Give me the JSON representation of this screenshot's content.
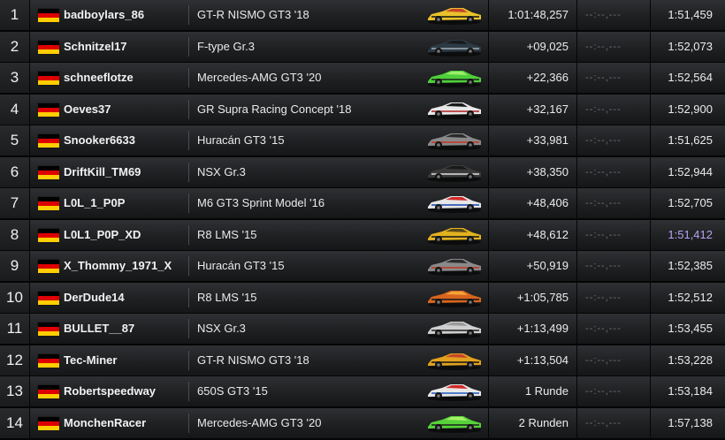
{
  "colors": {
    "fastest_lap": "#b8a2f2",
    "empty_field": "#6f7074",
    "flag": [
      "#000000",
      "#dd0000",
      "#ffce00"
    ]
  },
  "rows": [
    {
      "pos": "1",
      "flag": "flag-germany-icon",
      "name": "badboylars_86",
      "car": "GT-R NISMO GT3 '18",
      "car_colors": [
        "#e9c22a",
        "#1a1a1a",
        "#c7462c"
      ],
      "gap": "1:01:48,257",
      "empty": "--:--,---",
      "lap": "1:51,459",
      "fastest": false
    },
    {
      "pos": "2",
      "flag": "flag-germany-icon",
      "name": "Schnitzel17",
      "car": "F-type Gr.3",
      "car_colors": [
        "#2b3a44",
        "#9aa7b0",
        "#1a1a1a"
      ],
      "gap": "+09,025",
      "empty": "--:--,---",
      "lap": "1:52,073",
      "fastest": false
    },
    {
      "pos": "3",
      "flag": "flag-germany-icon",
      "name": "schneeflotze",
      "car": "Mercedes-AMG GT3 '20",
      "car_colors": [
        "#4fcf3a",
        "#1e2a1e",
        "#9bef6a"
      ],
      "gap": "+22,366",
      "empty": "--:--,---",
      "lap": "1:52,564",
      "fastest": false
    },
    {
      "pos": "4",
      "flag": "flag-germany-icon",
      "name": "Oeves37",
      "car": "GR Supra Racing Concept '18",
      "car_colors": [
        "#e8e8e8",
        "#b32a2a",
        "#1a1a1a"
      ],
      "gap": "+32,167",
      "empty": "--:--,---",
      "lap": "1:52,900",
      "fastest": false
    },
    {
      "pos": "5",
      "flag": "flag-germany-icon",
      "name": "Snooker6633",
      "car": "Huracán GT3 '15",
      "car_colors": [
        "#8a8a8a",
        "#c13a2a",
        "#2a2a2a"
      ],
      "gap": "+33,981",
      "empty": "--:--,---",
      "lap": "1:51,625",
      "fastest": false
    },
    {
      "pos": "6",
      "flag": "flag-germany-icon",
      "name": "DriftKill_TM69",
      "car": "NSX Gr.3",
      "car_colors": [
        "#3a3a3a",
        "#d7d7d7",
        "#1a1a1a"
      ],
      "gap": "+38,350",
      "empty": "--:--,---",
      "lap": "1:52,944",
      "fastest": false
    },
    {
      "pos": "7",
      "flag": "flag-germany-icon",
      "name": "L0L_1_P0P",
      "car": "M6 GT3 Sprint Model '16",
      "car_colors": [
        "#e6e6e6",
        "#1f4fb5",
        "#d22a2a"
      ],
      "gap": "+48,406",
      "empty": "--:--,---",
      "lap": "1:52,705",
      "fastest": false
    },
    {
      "pos": "8",
      "flag": "flag-germany-icon",
      "name": "L0L1_P0P_XD",
      "car": "R8 LMS '15",
      "car_colors": [
        "#e2b21f",
        "#1a1a1a",
        "#5a4a1a"
      ],
      "gap": "+48,612",
      "empty": "--:--,---",
      "lap": "1:51,412",
      "fastest": true
    },
    {
      "pos": "9",
      "flag": "flag-germany-icon",
      "name": "X_Thommy_1971_X",
      "car": "Huracán GT3 '15",
      "car_colors": [
        "#8a8a8a",
        "#b83a2a",
        "#2a2a2a"
      ],
      "gap": "+50,919",
      "empty": "--:--,---",
      "lap": "1:52,385",
      "fastest": false
    },
    {
      "pos": "10",
      "flag": "flag-germany-icon",
      "name": "DerDude14",
      "car": "R8 LMS '15",
      "car_colors": [
        "#d8651e",
        "#1a1a1a",
        "#f2a43a"
      ],
      "gap": "+1:05,785",
      "empty": "--:--,---",
      "lap": "1:52,512",
      "fastest": false
    },
    {
      "pos": "11",
      "flag": "flag-germany-icon",
      "name": "BULLET__87",
      "car": "NSX Gr.3",
      "car_colors": [
        "#cfcfcf",
        "#2a2a2a",
        "#9a9a9a"
      ],
      "gap": "+1:13,499",
      "empty": "--:--,---",
      "lap": "1:53,455",
      "fastest": false
    },
    {
      "pos": "12",
      "flag": "flag-germany-icon",
      "name": "Tec-Miner",
      "car": "GT-R NISMO GT3 '18",
      "car_colors": [
        "#e2a21f",
        "#1a1a1a",
        "#c7462c"
      ],
      "gap": "+1:13,504",
      "empty": "--:--,---",
      "lap": "1:53,228",
      "fastest": false
    },
    {
      "pos": "13",
      "flag": "flag-germany-icon",
      "name": "Robertspeedway",
      "car": "650S GT3 '15",
      "car_colors": [
        "#e8e8e8",
        "#2a5fc0",
        "#d22a2a"
      ],
      "gap": "1 Runde",
      "empty": "--:--,---",
      "lap": "1:53,184",
      "fastest": false
    },
    {
      "pos": "14",
      "flag": "flag-germany-icon",
      "name": "MonchenRacer",
      "car": "Mercedes-AMG GT3 '20",
      "car_colors": [
        "#58d23a",
        "#1e2a1e",
        "#a6f26a"
      ],
      "gap": "2  Runden",
      "empty": "--:--,---",
      "lap": "1:57,138",
      "fastest": false
    }
  ]
}
